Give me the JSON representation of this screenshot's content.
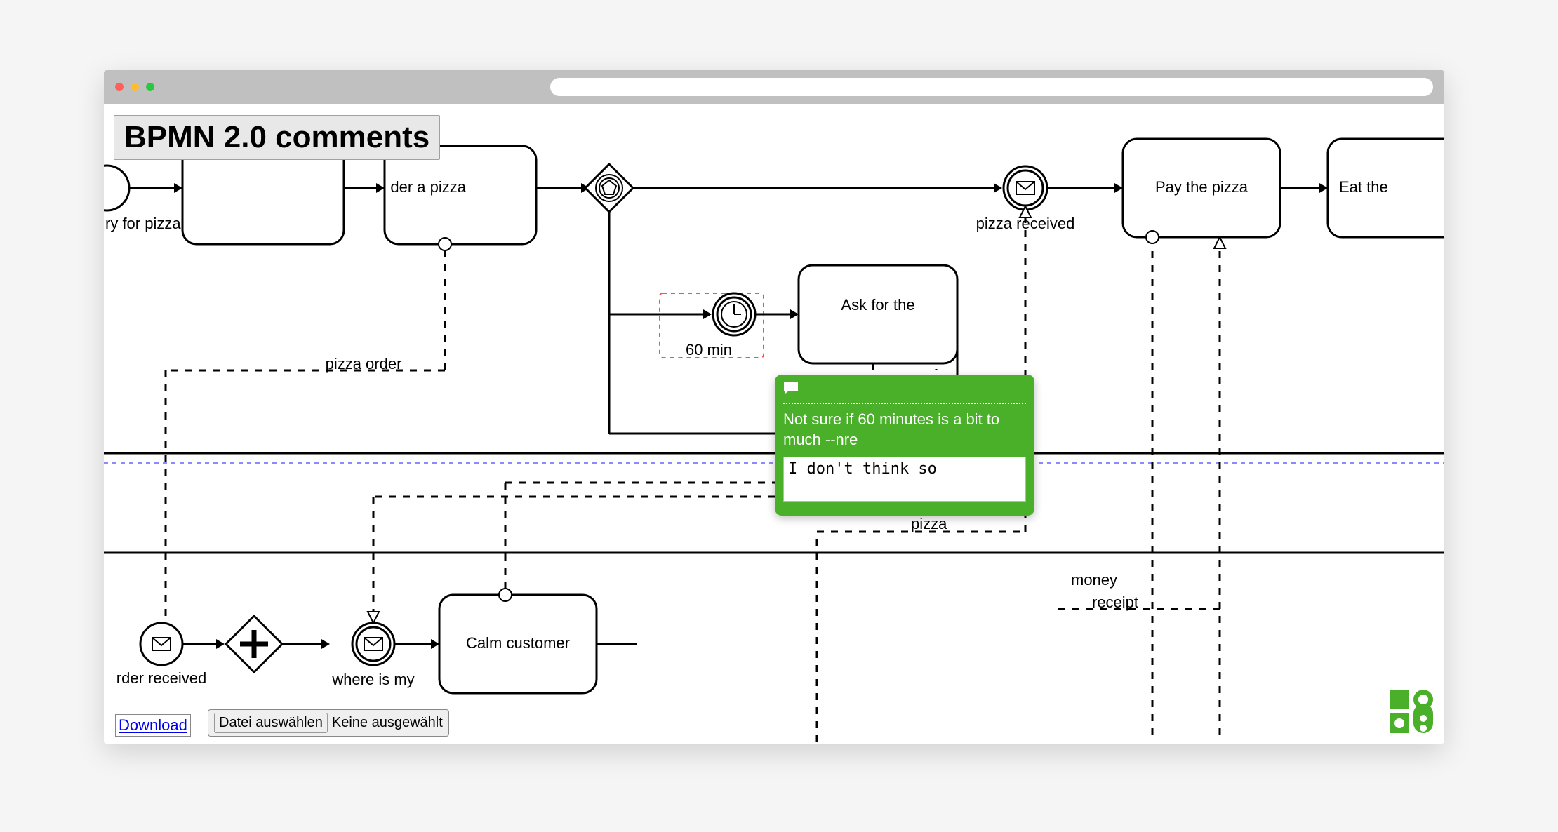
{
  "app": {
    "title": "BPMN 2.0 comments"
  },
  "nodes": {
    "hungry_label": "ry for pizza",
    "order_label_partial": "der a pizza",
    "timer_label": "60 min",
    "ask_pizza": "Ask for the",
    "pizza_received": "pizza received",
    "pay_pizza": "Pay the pizza",
    "eat_the": "Eat the",
    "order_received": "rder received",
    "where_is_my": "where is my",
    "calm_customer": "Calm customer"
  },
  "flows": {
    "pizza_order": "pizza order",
    "pizza": "pizza",
    "money": "money",
    "receipt": "receipt"
  },
  "comment": {
    "existing": "Not sure if 60 minutes is a bit to much --nre",
    "draft": "I don't think so"
  },
  "controls": {
    "download": "Download",
    "choose_file": "Datei auswählen",
    "no_file": "Keine ausgewählt"
  }
}
